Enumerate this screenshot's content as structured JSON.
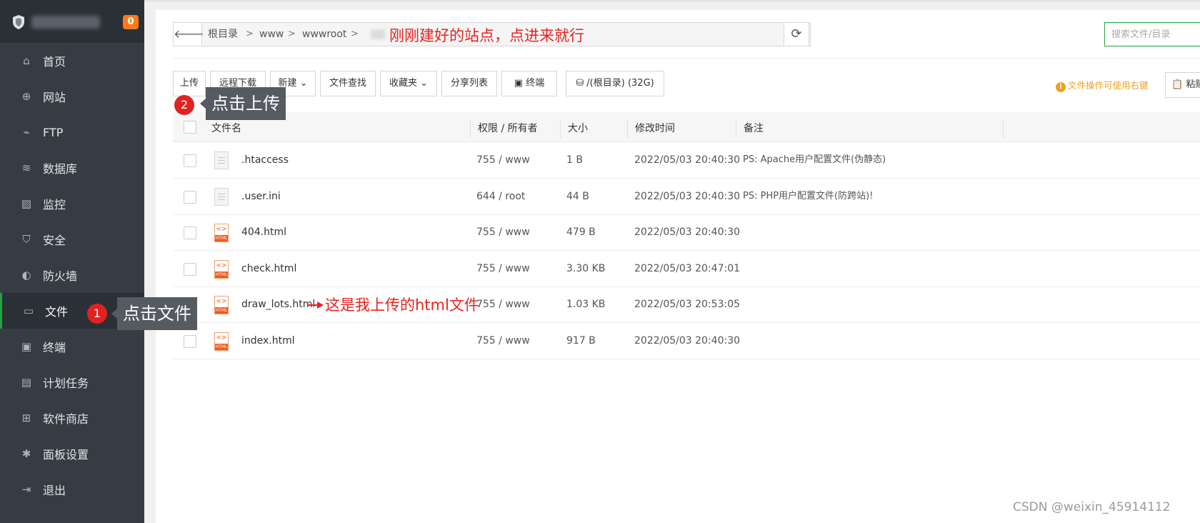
{
  "sidebar": {
    "badge": "0",
    "items": [
      {
        "label": "首页",
        "icon": "⌂",
        "icon_name": "home-icon"
      },
      {
        "label": "网站",
        "icon": "⊕",
        "icon_name": "globe-icon"
      },
      {
        "label": "FTP",
        "icon": "⌁",
        "icon_name": "ftp-icon"
      },
      {
        "label": "数据库",
        "icon": "≋",
        "icon_name": "database-icon"
      },
      {
        "label": "监控",
        "icon": "▨",
        "icon_name": "monitor-icon"
      },
      {
        "label": "安全",
        "icon": "⛉",
        "icon_name": "shield-icon"
      },
      {
        "label": "防火墙",
        "icon": "◐",
        "icon_name": "firewall-icon"
      },
      {
        "label": "文件",
        "icon": "▭",
        "icon_name": "folder-icon"
      },
      {
        "label": "终端",
        "icon": "▣",
        "icon_name": "terminal-icon"
      },
      {
        "label": "计划任务",
        "icon": "▤",
        "icon_name": "calendar-icon"
      },
      {
        "label": "软件商店",
        "icon": "⊞",
        "icon_name": "app-store-icon"
      },
      {
        "label": "面板设置",
        "icon": "✱",
        "icon_name": "gear-icon"
      },
      {
        "label": "退出",
        "icon": "⇥",
        "icon_name": "logout-icon"
      }
    ],
    "active_index": 7
  },
  "path": {
    "crumbs": [
      "根目录",
      "www",
      "wwwroot"
    ],
    "separator": ">"
  },
  "search": {
    "placeholder": "搜索文件/目录"
  },
  "toolbar": {
    "upload": "上传",
    "remote_download": "远程下载",
    "new": "新建",
    "find_file": "文件查找",
    "favorites": "收藏夹",
    "share_list": "分享列表",
    "terminal": "终端",
    "disk": "/(根目录) (32G)",
    "tip": "文件操作可使用右键",
    "paste": "粘贴"
  },
  "table": {
    "headers": {
      "name": "文件名",
      "perm": "权限 / 所有者",
      "size": "大小",
      "mtime": "修改时间",
      "note": "备注"
    },
    "rows": [
      {
        "name": ".htaccess",
        "perm": "755 / www",
        "size": "1 B",
        "mtime": "2022/05/03 20:40:30",
        "note": "PS: Apache用户配置文件(伪静态)",
        "type": "plain"
      },
      {
        "name": ".user.ini",
        "perm": "644 / root",
        "size": "44 B",
        "mtime": "2022/05/03 20:40:30",
        "note": "PS: PHP用户配置文件(防跨站)!",
        "type": "plain"
      },
      {
        "name": "404.html",
        "perm": "755 / www",
        "size": "479 B",
        "mtime": "2022/05/03 20:40:30",
        "note": "",
        "type": "html"
      },
      {
        "name": "check.html",
        "perm": "755 / www",
        "size": "3.30 KB",
        "mtime": "2022/05/03 20:47:01",
        "note": "",
        "type": "html"
      },
      {
        "name": "draw_lots.html",
        "perm": "755 / www",
        "size": "1.03 KB",
        "mtime": "2022/05/03 20:53:05",
        "note": "",
        "type": "html"
      },
      {
        "name": "index.html",
        "perm": "755 / www",
        "size": "917 B",
        "mtime": "2022/05/03 20:40:30",
        "note": "",
        "type": "html"
      }
    ]
  },
  "annotations": {
    "site_note": "刚刚建好的站点，点进来就行",
    "step1_num": "1",
    "step1_text": "点击文件",
    "step2_num": "2",
    "step2_text": "点击上传",
    "file_note": "这是我上传的html文件"
  },
  "watermark": "CSDN @weixin_45914112",
  "colors": {
    "accent": "#20a53a",
    "sidebar_bg": "#363c44",
    "annotation_red": "#e8221e",
    "badge_orange": "#ff7a1a"
  }
}
